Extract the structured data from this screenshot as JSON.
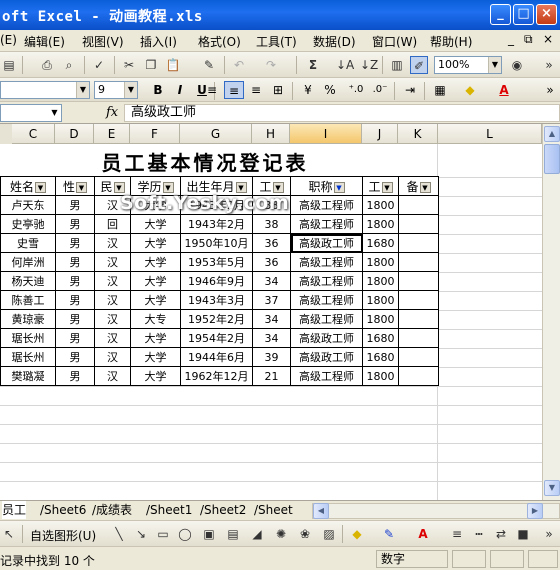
{
  "window": {
    "title": "oft Excel - 动画教程.xls",
    "buttons": [
      "_",
      "□",
      "×"
    ]
  },
  "menu": {
    "items": [
      "(E)",
      "编辑(E)",
      "视图(V)",
      "插入(I)",
      "格式(O)",
      "工具(T)",
      "数据(D)",
      "窗口(W)",
      "帮助(H)"
    ],
    "right_controls": [
      "_",
      "⧉",
      "×"
    ]
  },
  "standard_toolbar": {
    "zoom": "100%"
  },
  "formatting_toolbar": {
    "font_size": "9",
    "bold": "B",
    "italic": "I",
    "underline": "U",
    "percent": "%",
    "comma": ",",
    "increase_decimal": "⁺.0",
    "decrease_decimal": ".0⁻"
  },
  "formula_bar": {
    "name_box": "",
    "fx": "fx",
    "content": "高级政工师"
  },
  "columns": [
    "C",
    "D",
    "E",
    "F",
    "G",
    "H",
    "I",
    "J",
    "K",
    "L"
  ],
  "selected_column": "I",
  "sheet_title": "员工基本情况登记表",
  "table": {
    "headers": [
      "姓名",
      "性",
      "民",
      "学历",
      "出生年月",
      "工",
      "职称",
      "工",
      "备"
    ],
    "rows": [
      [
        "卢天东",
        "男",
        "汉",
        "大学",
        "1943年2月",
        "38",
        "高级工程师",
        "1800",
        ""
      ],
      [
        "史亭驰",
        "男",
        "回",
        "大学",
        "1943年2月",
        "38",
        "高级工程师",
        "1800",
        ""
      ],
      [
        "史雪",
        "男",
        "汉",
        "大学",
        "1950年10月",
        "36",
        "高级政工师",
        "1680",
        ""
      ],
      [
        "何岸洲",
        "男",
        "汉",
        "大学",
        "1953年5月",
        "36",
        "高级工程师",
        "1800",
        ""
      ],
      [
        "杨天迪",
        "男",
        "汉",
        "大学",
        "1946年9月",
        "34",
        "高级工程师",
        "1800",
        ""
      ],
      [
        "陈善工",
        "男",
        "汉",
        "大学",
        "1943年3月",
        "37",
        "高级工程师",
        "1800",
        ""
      ],
      [
        "黄琼豪",
        "男",
        "汉",
        "大专",
        "1952年2月",
        "34",
        "高级工程师",
        "1800",
        ""
      ],
      [
        "琚长州",
        "男",
        "汉",
        "大学",
        "1954年2月",
        "34",
        "高级政工师",
        "1680",
        ""
      ],
      [
        "琚长州",
        "男",
        "汉",
        "大学",
        "1944年6月",
        "39",
        "高级政工师",
        "1680",
        ""
      ],
      [
        "樊璐凝",
        "男",
        "汉",
        "大学",
        "1962年12月",
        "21",
        "高级工程师",
        "1800",
        ""
      ]
    ]
  },
  "watermark": "Soft.Yesky.com",
  "sheet_tabs": [
    "员工",
    "Sheet6",
    "成绩表",
    "Sheet1",
    "Sheet2",
    "Sheet"
  ],
  "drawing_toolbar": {
    "autoshapes": "自选图形(U)"
  },
  "status": {
    "message": "记录中找到 10 个",
    "mode": "数字"
  }
}
